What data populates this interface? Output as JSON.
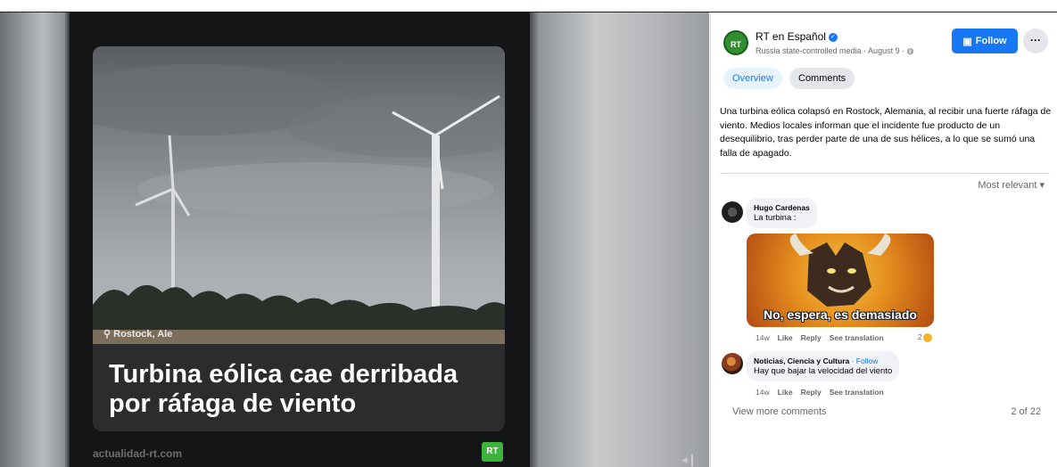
{
  "video": {
    "location": "Rostock, Ale",
    "headline_line1": "Turbina eólica cae derribada",
    "headline_line2": "por ráfaga de viento",
    "source": "actualidad-rt.com",
    "badge": "RT",
    "volume_icon": "volume-icon"
  },
  "post": {
    "avatar_text": "RT",
    "page_name": "RT en Español",
    "meta": "Russia state-controlled media · August 9 ·",
    "follow_label": "Follow",
    "more_label": "···",
    "tabs": [
      {
        "label": "Overview",
        "active": true
      },
      {
        "label": "Comments",
        "active": false
      }
    ],
    "description": "Una turbina eólica colapsó en Rostock, Alemania, al recibir una fuerte ráfaga de viento. Medios locales informan que el incidente fue producto de un desequilibrio, tras perder parte de una de sus hélices, a lo que se sumó una falla de apagado.",
    "sort_label": "Most relevant ▾"
  },
  "comments": [
    {
      "author": "Hugo Cardenas",
      "text": "La turbina :",
      "meme_caption": "No, espera, es demasiado",
      "time": "14w",
      "like": "Like",
      "reply": "Reply",
      "translate": "See translation",
      "reactions": "2"
    },
    {
      "author": "Noticias, Ciencia y Cultura",
      "follow": "· Follow",
      "text": "Hay que bajar la velocidad del viento",
      "time": "14w",
      "like": "Like",
      "reply": "Reply",
      "translate": "See translation"
    }
  ],
  "footer": {
    "view_more": "View more comments",
    "count": "2 of 22"
  },
  "colors": {
    "accent": "#1877f2",
    "rt_green": "#3cb43c"
  }
}
